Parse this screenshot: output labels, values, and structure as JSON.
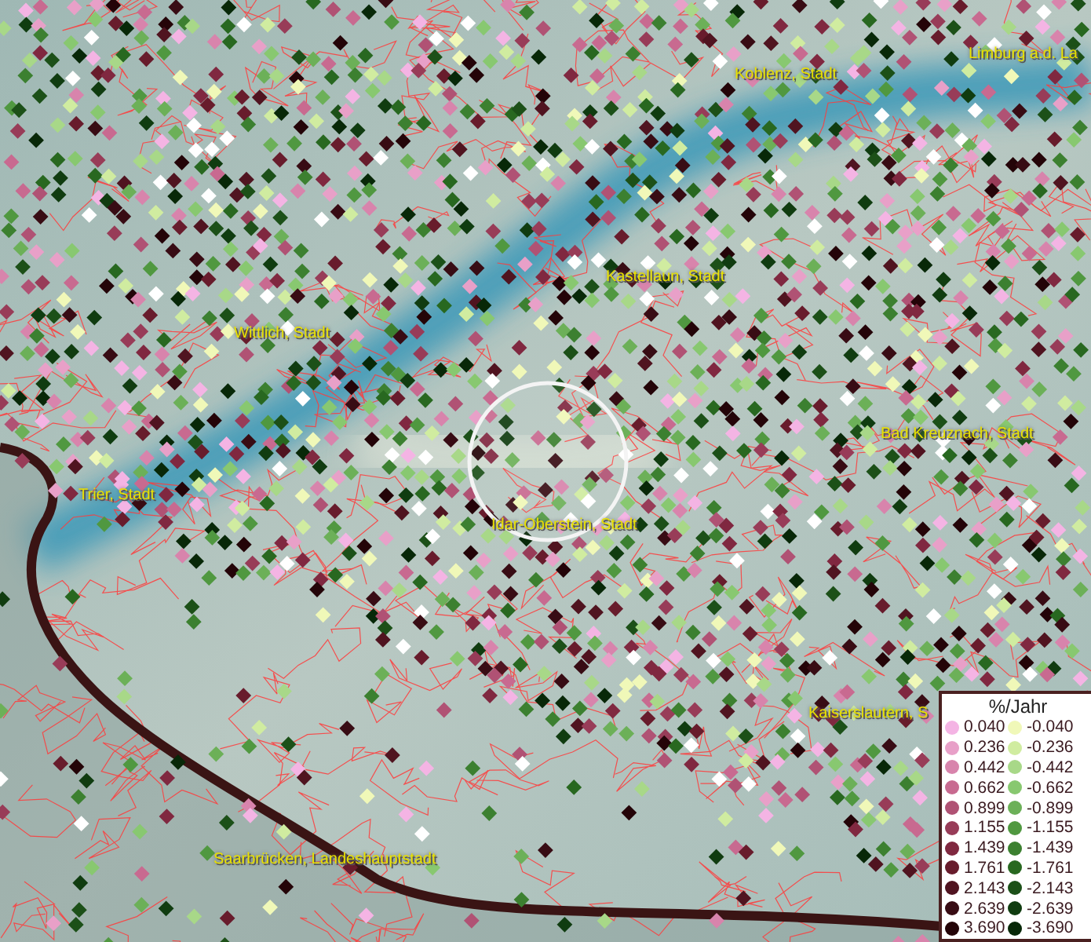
{
  "map": {
    "places": [
      {
        "name": "Koblenz, Stadt"
      },
      {
        "name": "Limburg a.d. La"
      },
      {
        "name": "Kastellaun, Stadt"
      },
      {
        "name": "Wittlich, Stadt"
      },
      {
        "name": "Bad Kreuznach, Stadt"
      },
      {
        "name": "Trier, Stadt"
      },
      {
        "name": "Idar-Oberstein, Stadt"
      },
      {
        "name": "Kaiserslautern, S"
      },
      {
        "name": "Saarbrücken, Landeshauptstadt"
      }
    ]
  },
  "legend": {
    "title": "%/Jahr",
    "positive": [
      {
        "label": "0.040",
        "color": "#f4b4e4"
      },
      {
        "label": "0.236",
        "color": "#e8a0c8"
      },
      {
        "label": "0.442",
        "color": "#d884ac"
      },
      {
        "label": "0.662",
        "color": "#c86a90"
      },
      {
        "label": "0.899",
        "color": "#b05274"
      },
      {
        "label": "1.155",
        "color": "#983c58"
      },
      {
        "label": "1.439",
        "color": "#802840"
      },
      {
        "label": "1.761",
        "color": "#681c2c"
      },
      {
        "label": "2.143",
        "color": "#501420"
      },
      {
        "label": "2.639",
        "color": "#380c14"
      },
      {
        "label": "3.690",
        "color": "#240408"
      }
    ],
    "negative": [
      {
        "label": "-0.040",
        "color": "#f0f8b8"
      },
      {
        "label": "-0.236",
        "color": "#d0eca0"
      },
      {
        "label": "-0.442",
        "color": "#a8d888"
      },
      {
        "label": "-0.662",
        "color": "#88c870"
      },
      {
        "label": "-0.899",
        "color": "#6cb058"
      },
      {
        "label": "-1.155",
        "color": "#509840"
      },
      {
        "label": "-1.439",
        "color": "#3c8030"
      },
      {
        "label": "-1.761",
        "color": "#286820"
      },
      {
        "label": "-2.143",
        "color": "#1c5018"
      },
      {
        "label": "-2.639",
        "color": "#103c10"
      },
      {
        "label": "-3.690",
        "color": "#082808"
      }
    ]
  }
}
